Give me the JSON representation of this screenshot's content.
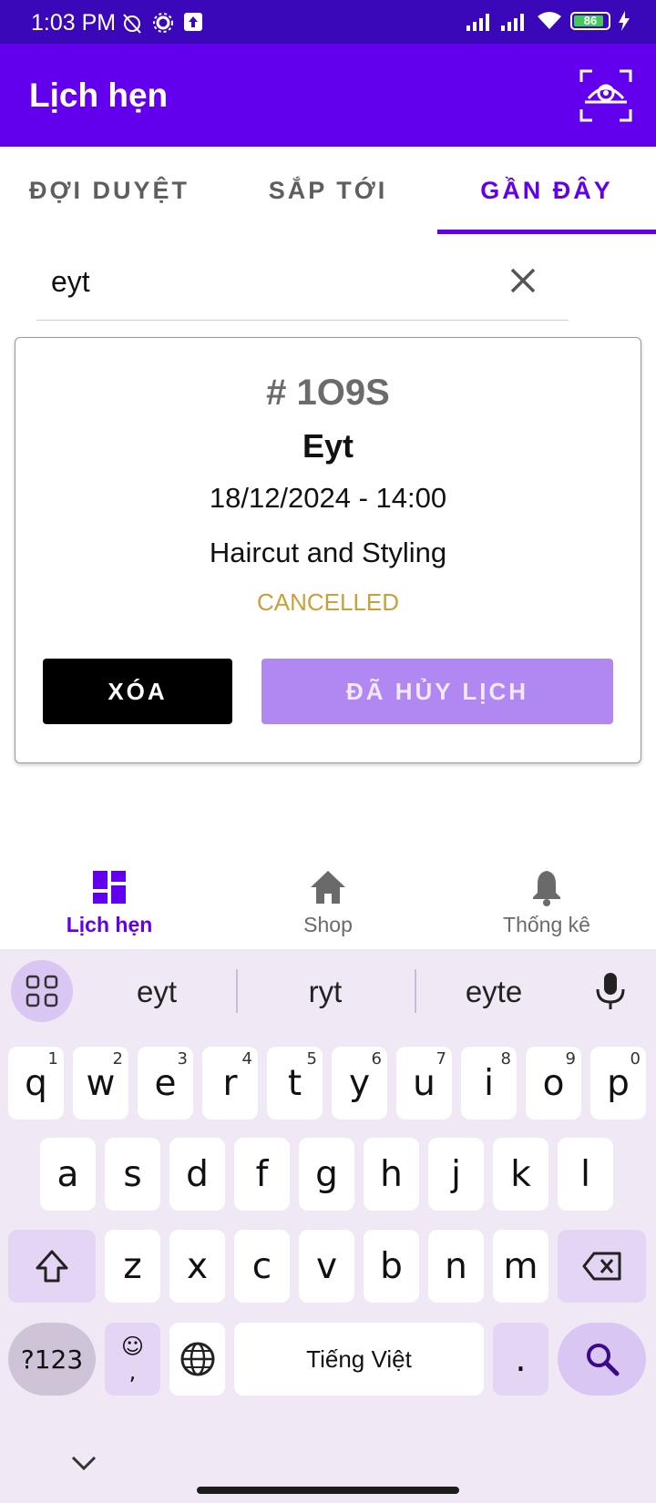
{
  "status_bar": {
    "time": "1:03 PM",
    "battery": "86"
  },
  "app_bar": {
    "title": "Lịch hẹn"
  },
  "tabs": [
    {
      "label": "ĐỢI DUYỆT",
      "active": false
    },
    {
      "label": "SẮP TỚI",
      "active": false
    },
    {
      "label": "GẦN ĐÂY",
      "active": true
    }
  ],
  "search": {
    "value": "eyt",
    "placeholder": ""
  },
  "appointment": {
    "code": "# 1O9S",
    "name": "Eyt",
    "datetime": "18/12/2024 - 14:00",
    "service": "Haircut and Styling",
    "status": "CANCELLED",
    "delete_label": "XÓA",
    "cancelled_label": "ĐÃ HỦY LỊCH"
  },
  "bottom_nav": [
    {
      "label": "Lịch hẹn",
      "icon": "dashboard-icon",
      "active": true
    },
    {
      "label": "Shop",
      "icon": "home-icon",
      "active": false
    },
    {
      "label": "Thống kê",
      "icon": "bell-icon",
      "active": false
    }
  ],
  "keyboard": {
    "suggestions": [
      "eyt",
      "ryt",
      "eyte"
    ],
    "row1": [
      {
        "k": "q",
        "h": "1"
      },
      {
        "k": "w",
        "h": "2"
      },
      {
        "k": "e",
        "h": "3"
      },
      {
        "k": "r",
        "h": "4"
      },
      {
        "k": "t",
        "h": "5"
      },
      {
        "k": "y",
        "h": "6"
      },
      {
        "k": "u",
        "h": "7"
      },
      {
        "k": "i",
        "h": "8"
      },
      {
        "k": "o",
        "h": "9"
      },
      {
        "k": "p",
        "h": "0"
      }
    ],
    "row2": [
      "a",
      "s",
      "d",
      "f",
      "g",
      "h",
      "j",
      "k",
      "l"
    ],
    "row3": [
      "z",
      "x",
      "c",
      "v",
      "b",
      "n",
      "m"
    ],
    "symbols_label": "?123",
    "emoji_label": "☺",
    "comma_label": ",",
    "space_label": "Tiếng Việt",
    "period_label": "."
  },
  "colors": {
    "status_bar": "#3a08b8",
    "primary": "#6200ee",
    "cancelled_button": "#b187f2",
    "status_cancelled": "#c9a13a",
    "keyboard_bg": "#f0e8f5"
  }
}
